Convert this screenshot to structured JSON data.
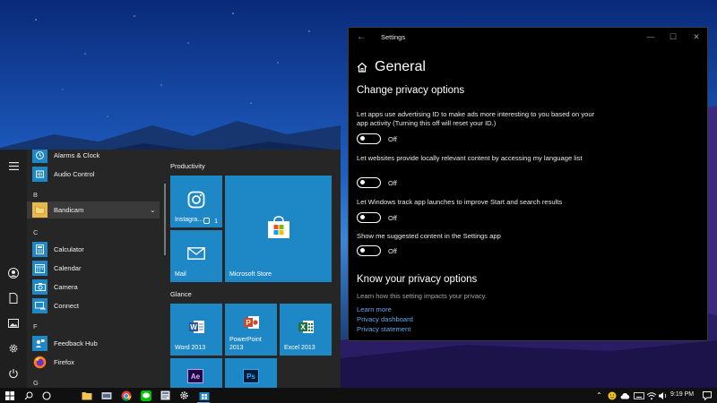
{
  "colors": {
    "accent": "#1e88c7",
    "tile_blue": "#1e88c7",
    "link": "#62a8f0",
    "start_bg": "#262626",
    "settings_bg": "#000000",
    "taskbar_bg": "#101010"
  },
  "start_menu": {
    "rail_icons": [
      "hamburger-icon",
      "user-icon",
      "document-icon",
      "pictures-icon",
      "gear-icon",
      "power-icon"
    ],
    "apps": [
      {
        "label": "Alarms & Clock",
        "icon": "alarm-clock-icon"
      },
      {
        "label": "Audio Control",
        "icon": "audio-control-icon"
      },
      {
        "label": "B",
        "type": "letter"
      },
      {
        "label": "Bandicam",
        "icon": "folder-icon"
      },
      {
        "label": "C",
        "type": "letter"
      },
      {
        "label": "Calculator",
        "icon": "calculator-icon"
      },
      {
        "label": "Calendar",
        "icon": "calendar-icon"
      },
      {
        "label": "Camera",
        "icon": "camera-icon"
      },
      {
        "label": "Connect",
        "icon": "connect-icon"
      },
      {
        "label": "F",
        "type": "letter"
      },
      {
        "label": "Feedback Hub",
        "icon": "feedback-hub-icon"
      },
      {
        "label": "Firefox",
        "icon": "firefox-icon"
      },
      {
        "label": "G",
        "type": "letter"
      }
    ],
    "groups": {
      "productivity": "Productivity",
      "glance": "Glance"
    },
    "tiles": {
      "instagram": {
        "label": "Instagra...",
        "badge": "1"
      },
      "store": {
        "label": "Microsoft Store"
      },
      "mail": {
        "label": "Mail"
      },
      "word": {
        "label": "Word 2013"
      },
      "powerpoint": {
        "label": "PowerPoint 2013"
      },
      "excel": {
        "label": "Excel 2013"
      }
    }
  },
  "settings": {
    "window_title": "Settings",
    "page_title": "General",
    "section1_title": "Change privacy options",
    "options": [
      {
        "text": "Let apps use advertising ID to make ads more interesting to you based on your app activity (Turning this off will reset your ID.)",
        "state": "Off"
      },
      {
        "text": "Let websites provide locally relevant content by accessing my language list",
        "state": "Off"
      },
      {
        "text": "Let Windows track app launches to improve Start and search results",
        "state": "Off"
      },
      {
        "text": "Show me suggested content in the Settings app",
        "state": "Off"
      }
    ],
    "section2_title": "Know your privacy options",
    "section2_desc": "Learn how this setting impacts your privacy.",
    "links": [
      "Learn more",
      "Privacy dashboard",
      "Privacy statement"
    ]
  },
  "taskbar": {
    "icons": [
      "windows-start-icon",
      "search-icon",
      "task-view-icon",
      "file-explorer-icon",
      "app-icon",
      "chrome-icon",
      "line-icon",
      "files-icon",
      "settings-gear-icon",
      "store-icon"
    ],
    "tray_icons": [
      "chevron-up-icon",
      "emoji-icon",
      "cloud-icon",
      "keyboard-icon",
      "wifi-icon",
      "volume-icon"
    ],
    "clock": "9:19 PM"
  }
}
